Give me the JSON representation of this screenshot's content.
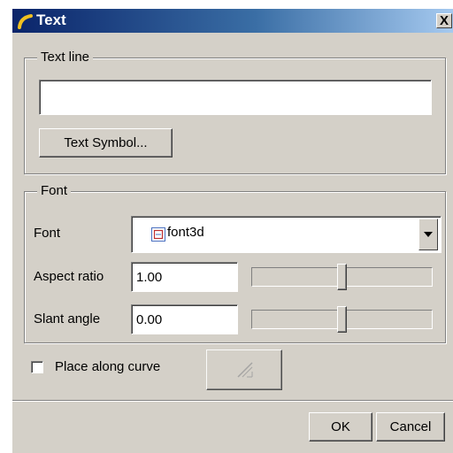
{
  "window": {
    "title": "Text",
    "close_glyph": "X",
    "icon": "curve-icon"
  },
  "text_line_group": {
    "legend": "Text line",
    "input_value": "",
    "symbol_button_label": "Text Symbol..."
  },
  "font_group": {
    "legend": "Font",
    "font_label": "Font",
    "font_value": "font3d",
    "font_icon": "font-symbol-icon",
    "aspect_label": "Aspect ratio",
    "aspect_value": "1.00",
    "aspect_slider_level": 0.5,
    "slant_label": "Slant angle",
    "slant_value": "0.00",
    "slant_slider_level": 0.5
  },
  "curve": {
    "checkbox_label": "Place along curve",
    "checked": false,
    "pick_icon": "pick-curve-icon"
  },
  "footer": {
    "ok_label": "OK",
    "cancel_label": "Cancel"
  },
  "colors": {
    "title_gradient_start": "#0a246a",
    "title_gradient_end": "#a6caf0",
    "face": "#d4d0c8"
  }
}
